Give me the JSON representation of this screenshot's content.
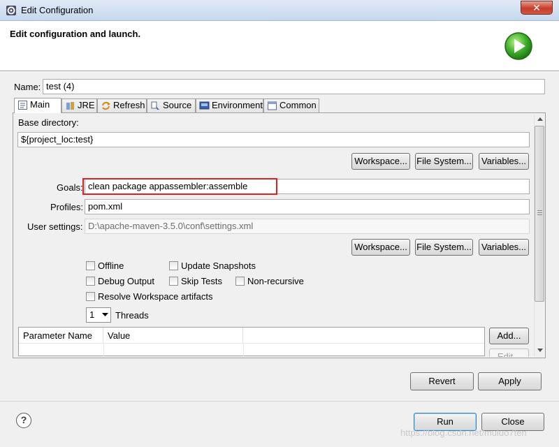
{
  "window": {
    "title": "Edit Configuration",
    "close_glyph": "✕"
  },
  "header": {
    "title": "Edit configuration and launch."
  },
  "name": {
    "label": "Name:",
    "value": "test (4)"
  },
  "tabs": [
    {
      "label": "Main",
      "icon": "main-tab-icon"
    },
    {
      "label": "JRE",
      "icon": "jre-icon"
    },
    {
      "label": "Refresh",
      "icon": "refresh-icon"
    },
    {
      "label": "Source",
      "icon": "source-icon"
    },
    {
      "label": "Environment",
      "icon": "environment-icon"
    },
    {
      "label": "Common",
      "icon": "common-icon"
    }
  ],
  "main": {
    "base_directory": {
      "label": "Base directory:",
      "value": "${project_loc:test}"
    },
    "buttons1": {
      "workspace": "Workspace...",
      "filesystem": "File System...",
      "variables": "Variables..."
    },
    "goals": {
      "label": "Goals:",
      "value": "clean package appassembler:assemble"
    },
    "profiles": {
      "label": "Profiles:",
      "value": "pom.xml"
    },
    "user_settings": {
      "label": "User settings:",
      "value": "D:\\apache-maven-3.5.0\\conf\\settings.xml"
    },
    "buttons2": {
      "workspace": "Workspace...",
      "filesystem": "File System...",
      "variables": "Variables..."
    },
    "options": {
      "offline": "Offline",
      "update_snapshots": "Update Snapshots",
      "debug_output": "Debug Output",
      "skip_tests": "Skip Tests",
      "non_recursive": "Non-recursive",
      "resolve_workspace": "Resolve Workspace artifacts"
    },
    "threads": {
      "value": "1",
      "label": "Threads"
    },
    "param_table": {
      "col_name": "Parameter Name",
      "col_value": "Value",
      "add_button": "Add...",
      "edit_button": "Edit..."
    }
  },
  "footer": {
    "revert": "Revert",
    "apply": "Apply",
    "run": "Run",
    "close": "Close",
    "help_glyph": "?"
  },
  "watermark": "https://blog.csdn.net/muluo7ten",
  "colors": {
    "highlight_box": "#e02020",
    "accent": "#3c7fb1"
  }
}
